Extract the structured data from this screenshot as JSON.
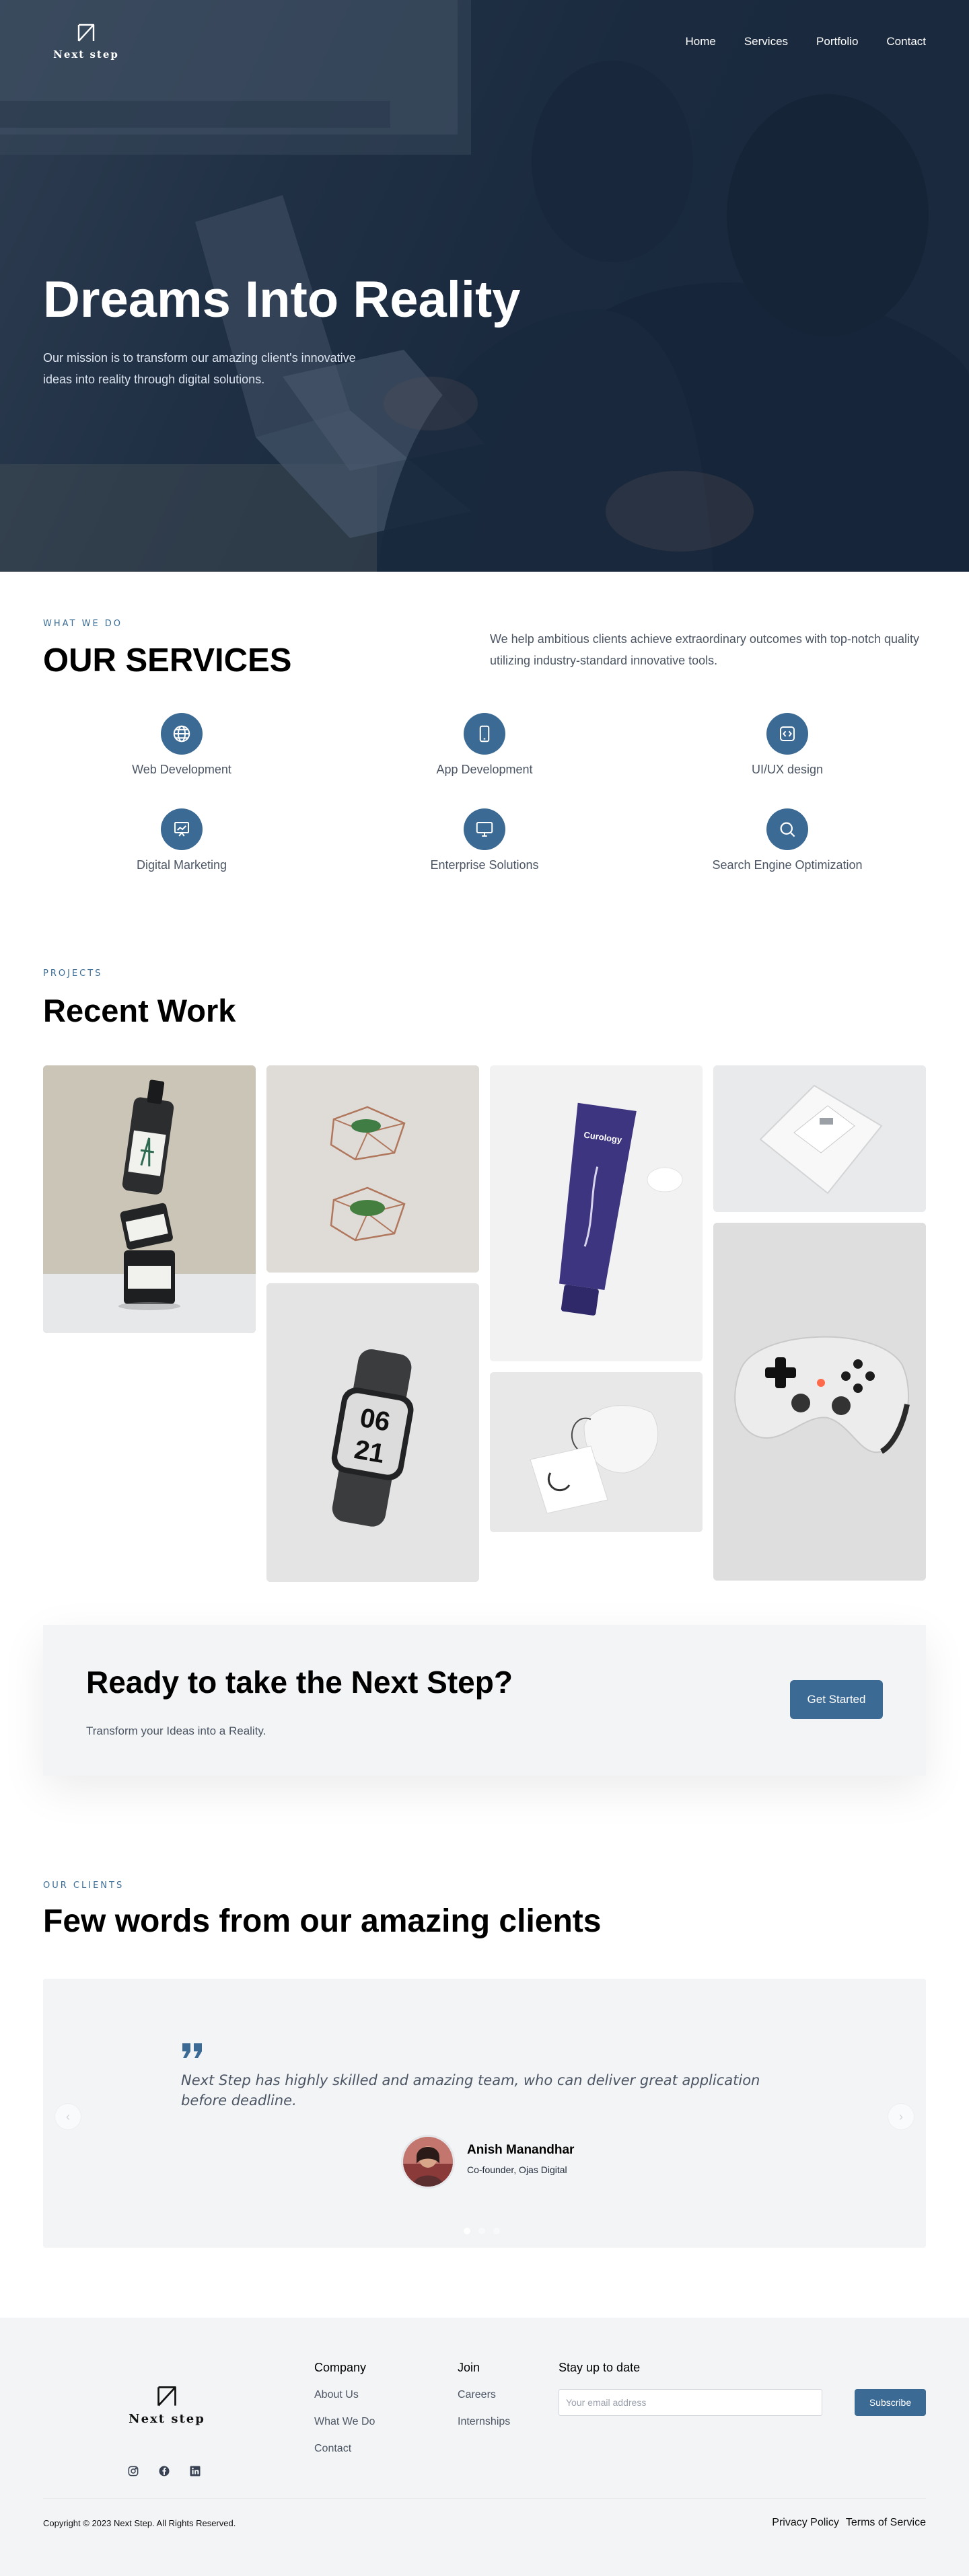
{
  "brand": {
    "name": "Next step",
    "accent": "#3b6a94"
  },
  "nav": {
    "items": [
      "Home",
      "Services",
      "Portfolio",
      "Contact"
    ]
  },
  "hero": {
    "title": "Dreams Into Reality",
    "text": "Our mission is to transform our amazing client's innovative ideas into reality through digital solutions."
  },
  "services": {
    "eyebrow": "WHAT WE DO",
    "title": "OUR SERVICES",
    "description": "We help ambitious clients achieve extraordinary outcomes with top-notch quality utilizing industry-standard innovative tools.",
    "items": [
      {
        "label": "Web Development",
        "icon": "globe-icon"
      },
      {
        "label": "App Development",
        "icon": "smartphone-icon"
      },
      {
        "label": "UI/UX design",
        "icon": "code-window-icon"
      },
      {
        "label": "Digital Marketing",
        "icon": "presentation-chart-icon"
      },
      {
        "label": "Enterprise Solutions",
        "icon": "monitor-icon"
      },
      {
        "label": "Search Engine Optimization",
        "icon": "search-icon"
      }
    ]
  },
  "projects": {
    "eyebrow": "PROJECTS",
    "title": "Recent Work",
    "tiles": [
      "bottles-photo",
      "geometric-planters-photo",
      "tube-cream-photo",
      "packaging-box-photo",
      "smartwatch-photo",
      "pouch-card-photo",
      "game-controller-photo"
    ],
    "watch_numbers": [
      "06",
      "21"
    ],
    "tube_brand": "Curology"
  },
  "cta": {
    "title": "Ready to take the Next Step?",
    "text": "Transform your Ideas into a Reality.",
    "button": "Get Started"
  },
  "testimonials": {
    "eyebrow": "OUR CLIENTS",
    "title": "Few words from our amazing clients",
    "quote": "Next Step has highly skilled and amazing team, who can deliver great application before deadline.",
    "client_name": "Anish Manandhar",
    "client_role": "Co-founder, Ojas Digital",
    "slides": 3,
    "active_slide": 1
  },
  "footer": {
    "brand": "Next step",
    "company_title": "Company",
    "company_links": [
      "About Us",
      "What We Do",
      "Contact"
    ],
    "join_title": "Join",
    "join_links": [
      "Careers",
      "Internships"
    ],
    "newsletter_title": "Stay up to date",
    "email_placeholder": "Your email address",
    "subscribe": "Subscribe",
    "socials": [
      "instagram-icon",
      "facebook-icon",
      "linkedin-icon"
    ],
    "copyright": "Copyright © 2023 Next Step. All Rights Reserved.",
    "legal_links": [
      "Privacy Policy",
      "Terms of Service"
    ]
  }
}
